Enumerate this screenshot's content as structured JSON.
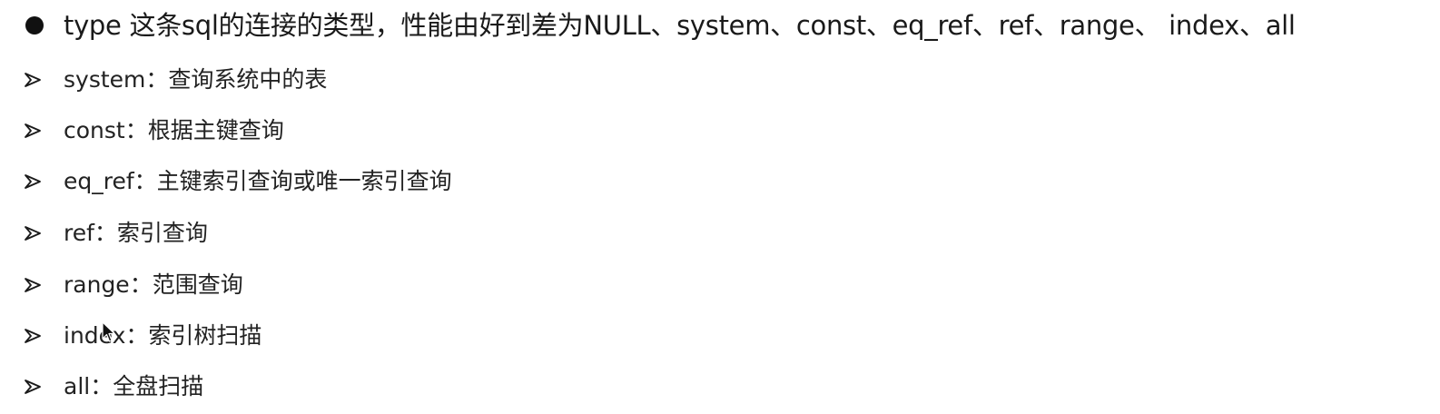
{
  "heading": {
    "text": "type 这条sql的连接的类型，性能由好到差为NULL、system、const、eq_ref、ref、range、 index、all"
  },
  "items": [
    {
      "text": "system：查询系统中的表"
    },
    {
      "text": "const：根据主键查询"
    },
    {
      "text": "eq_ref：主键索引查询或唯一索引查询"
    },
    {
      "text": "ref：索引查询"
    },
    {
      "text": "range：范围查询"
    },
    {
      "text": "index：索引树扫描"
    },
    {
      "text": "all：全盘扫描"
    }
  ],
  "icons": {
    "heading_bullet": "filled-circle-bullet-icon",
    "item_bullet": "arrowhead-bullet-icon",
    "cursor": "mouse-pointer-icon"
  }
}
